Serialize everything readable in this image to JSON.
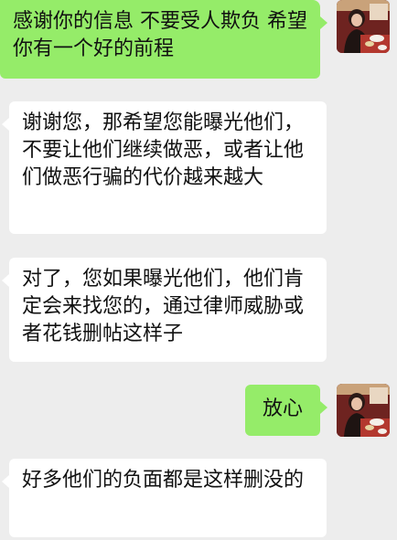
{
  "messages": [
    {
      "side": "out",
      "text": "感谢你的信息 不要受人欺负 希望你有一个好的前程",
      "avatar": "user-avatar"
    },
    {
      "side": "in",
      "text": "谢谢您，那希望您能曝光他们，不要让他们继续做恶，或者让他们做恶行骗的代价越来越大"
    },
    {
      "side": "in",
      "text": "对了，您如果曝光他们，他们肯定会来找您的，通过律师威胁或者花钱删帖这样子"
    },
    {
      "side": "out",
      "text": "放心",
      "avatar": "user-avatar"
    },
    {
      "side": "in",
      "text": "好多他们的负面都是这样删没的"
    }
  ]
}
